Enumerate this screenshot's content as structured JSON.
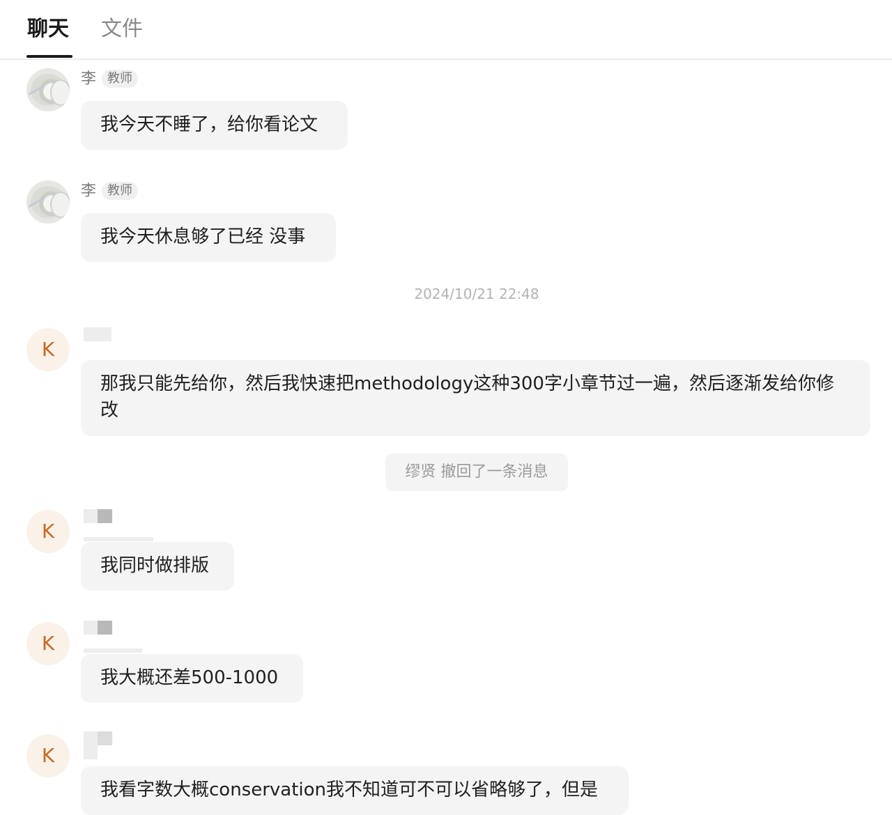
{
  "tabs": [
    {
      "label": "聊天",
      "active": true
    },
    {
      "label": "文件",
      "active": false
    }
  ],
  "messages": [
    {
      "sender": "李",
      "role": "教师",
      "avatar": "photo-avatar",
      "text": "我今天不睡了，给你看论文"
    },
    {
      "sender": "李",
      "role": "教师",
      "avatar": "photo-avatar",
      "text": "我今天休息够了已经 没事"
    },
    {
      "sender": "",
      "avatar_letter": "K",
      "text": "那我只能先给你，然后我快速把methodology这种300字小章节过一遍，然后逐渐发给你修改"
    },
    {
      "sender": "",
      "avatar_letter": "K",
      "text": "我同时做排版"
    },
    {
      "sender": "",
      "avatar_letter": "K",
      "text": "我大概还差500-1000"
    },
    {
      "sender": "",
      "avatar_letter": "K",
      "text": "我看字数大概conservation我不知道可不可以省略够了，但是"
    }
  ],
  "timestamp": "2024/10/21 22:48",
  "system_note": "缪贤 撤回了一条消息",
  "colors": {
    "accent_text": "#1a1a1a",
    "bubble_bg": "#f4f4f4",
    "avatar_letter": "#c46a25",
    "avatar_bg": "#faf1e9"
  }
}
